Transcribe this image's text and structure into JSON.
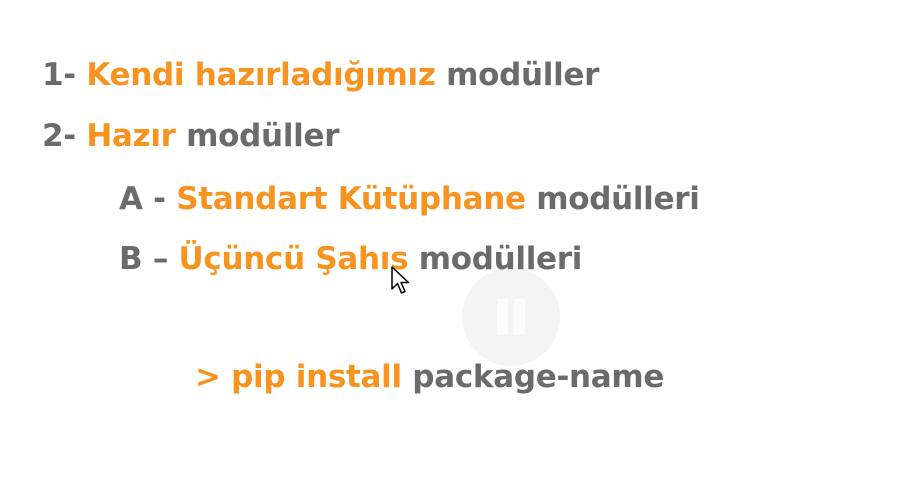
{
  "slide": {
    "line1": {
      "prefix": "1- ",
      "highlight": "Kendi hazırladığımız",
      "suffix": " modüller"
    },
    "line2": {
      "prefix": "2- ",
      "highlight": "Hazır",
      "suffix": " modüller"
    },
    "line3": {
      "prefix": "A - ",
      "highlight": "Standart Kütüphane",
      "suffix": " modülleri"
    },
    "line4": {
      "prefix": "B – ",
      "highlight": "Üçüncü Şahıs",
      "suffix": " modülleri"
    },
    "line5": {
      "highlight": "> pip install",
      "suffix": " package-name"
    }
  },
  "colors": {
    "highlight": "#f7931e",
    "text": "#6b6b6b",
    "background": "#ffffff"
  },
  "icons": {
    "overlay": "pause-icon",
    "pointer": "mouse-cursor-icon"
  }
}
